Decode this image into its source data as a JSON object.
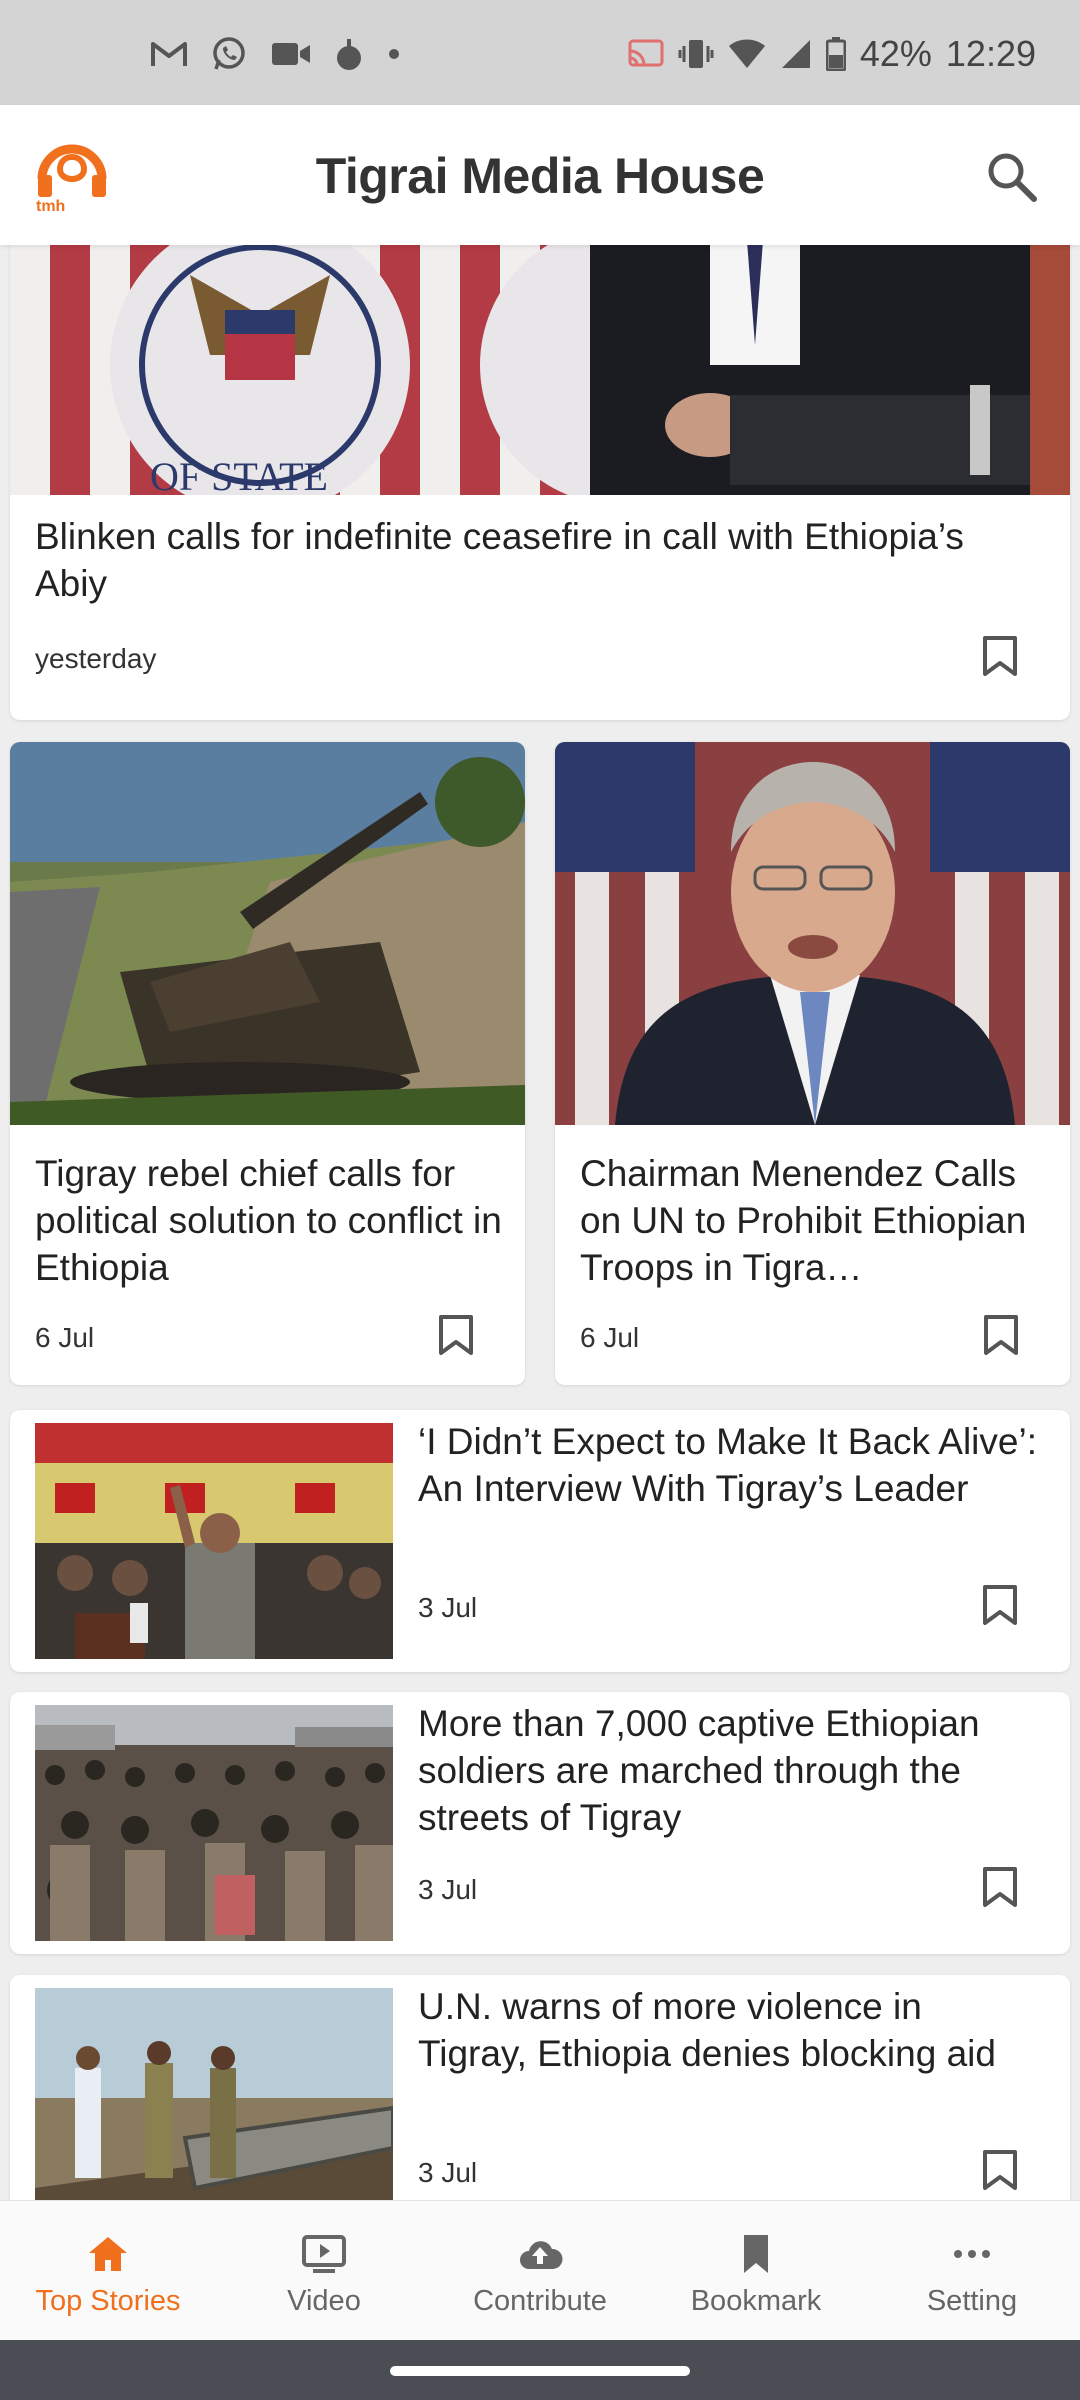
{
  "status_bar": {
    "battery": "42%",
    "time": "12:29"
  },
  "app_bar": {
    "title": "Tigrai Media House",
    "logo_text": "tmh"
  },
  "colors": {
    "accent": "#f0701e",
    "text": "#222222"
  },
  "articles": [
    {
      "title": "Blinken calls for indefinite ceasefire in call with Ethiopia’s Abiy",
      "date": "yesterday"
    },
    {
      "title": "Tigray rebel chief calls for political solution to conflict in Ethiopia",
      "date": "6 Jul"
    },
    {
      "title": "Chairman Menendez Calls on UN to Prohibit Ethiopian Troops in Tigra…",
      "date": "6 Jul"
    },
    {
      "title": "‘I Didn’t Expect to Make It Back Alive’: An Interview With Tigray’s Leader",
      "date": "3 Jul"
    },
    {
      "title": "More than 7,000 captive Ethiopian soldiers are marched through the streets of Tigray",
      "date": "3 Jul"
    },
    {
      "title": "U.N. warns of more violence in Tigray, Ethiopia denies blocking aid",
      "date": "3 Jul"
    }
  ],
  "bottom_nav": {
    "items": [
      {
        "label": "Top Stories",
        "icon": "home-icon",
        "active": true
      },
      {
        "label": "Video",
        "icon": "video-icon",
        "active": false
      },
      {
        "label": "Contribute",
        "icon": "upload-cloud-icon",
        "active": false
      },
      {
        "label": "Bookmark",
        "icon": "bookmark-icon",
        "active": false
      },
      {
        "label": "Setting",
        "icon": "more-icon",
        "active": false
      }
    ]
  }
}
